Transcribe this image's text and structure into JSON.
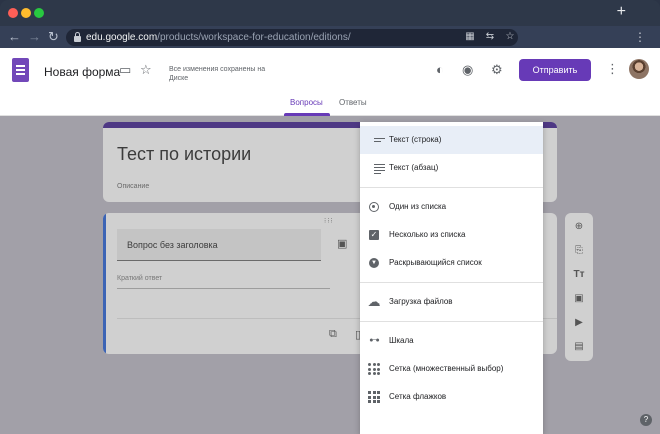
{
  "browser": {
    "url_host": "edu.google.com",
    "url_path": "/products/workspace-for-education/editions/",
    "new_tab": "+"
  },
  "header": {
    "form_title": "Новая форма",
    "save_status": "Все изменения сохранены на Диске",
    "send_label": "Отправить"
  },
  "tabs": {
    "questions": "Вопросы",
    "answers": "Ответы"
  },
  "form": {
    "title": "Тест по истории",
    "description": "Описание",
    "question_title": "Вопрос без заголовка",
    "short_answer": "Краткий ответ"
  },
  "menu": {
    "items": [
      {
        "label": "Текст (строка)",
        "icon": "short-text-icon"
      },
      {
        "label": "Текст (абзац)",
        "icon": "paragraph-icon"
      },
      {
        "label": "Один из списка",
        "icon": "radio-icon"
      },
      {
        "label": "Несколько из списка",
        "icon": "checkbox-icon"
      },
      {
        "label": "Раскрывающийся список",
        "icon": "dropdown-icon"
      },
      {
        "label": "Загрузка файлов",
        "icon": "cloud-upload-icon"
      },
      {
        "label": "Шкала",
        "icon": "scale-icon"
      },
      {
        "label": "Сетка (множественный выбор)",
        "icon": "grid-dots-icon"
      },
      {
        "label": "Сетка флажков",
        "icon": "grid-squares-icon"
      }
    ]
  },
  "colors": {
    "accent": "#673ab7",
    "question_accent": "#3c64b5"
  }
}
